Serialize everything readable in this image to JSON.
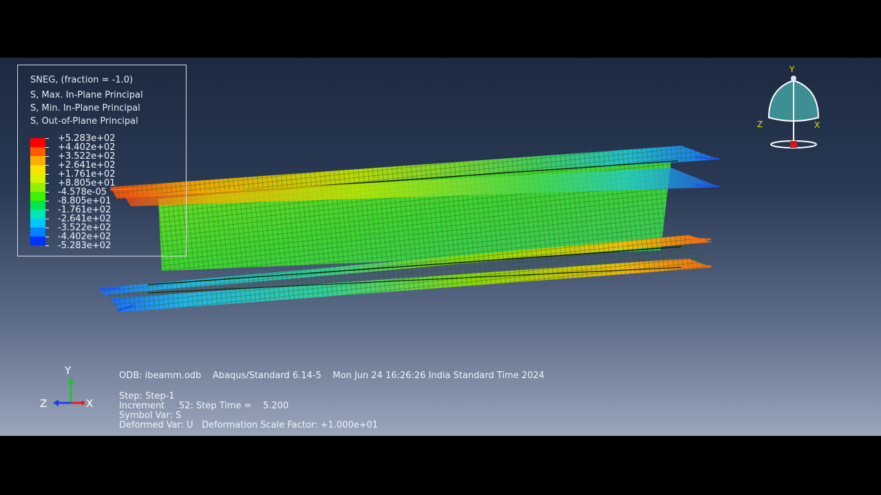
{
  "legend": {
    "lines": [
      "SNEG, (fraction = -1.0)",
      "S, Max. In-Plane Principal",
      "S, Min. In-Plane Principal",
      "S, Out-of-Plane Principal"
    ],
    "values": [
      "+5.283e+02",
      "+4.402e+02",
      "+3.522e+02",
      "+2.641e+02",
      "+1.761e+02",
      "+8.805e+01",
      "-4.578e-05",
      "-8.805e+01",
      "-1.761e+02",
      "-2.641e+02",
      "-3.522e+02",
      "-4.402e+02",
      "-5.283e+02"
    ],
    "colors": [
      "#ff0000",
      "#ff5a00",
      "#ffae00",
      "#ffe100",
      "#d9f200",
      "#8ef200",
      "#3ff200",
      "#00e64d",
      "#00e6b4",
      "#00c8ff",
      "#0082ff",
      "#0032ff"
    ]
  },
  "triad_small": {
    "x_label": "X",
    "y_label": "Y",
    "z_label": "Z"
  },
  "triad_big": {
    "x_label": "X",
    "y_label": "Y",
    "z_label": "Z"
  },
  "info": {
    "odb_line": "ODB: ibeamm.odb    Abaqus/Standard 6.14-5    Mon Jun 24 16:26:26 India Standard Time 2024",
    "step": "Step: Step-1",
    "increment": "Increment     52: Step Time =    5.200",
    "symbol_var": "Symbol Var: S",
    "deformed_var": "Deformed Var: U   Deformation Scale Factor: +1.000e+01"
  },
  "colors": {
    "bg_top": "#1c2a40",
    "bg_bottom": "#9aa6bb",
    "frame": "#000000"
  }
}
